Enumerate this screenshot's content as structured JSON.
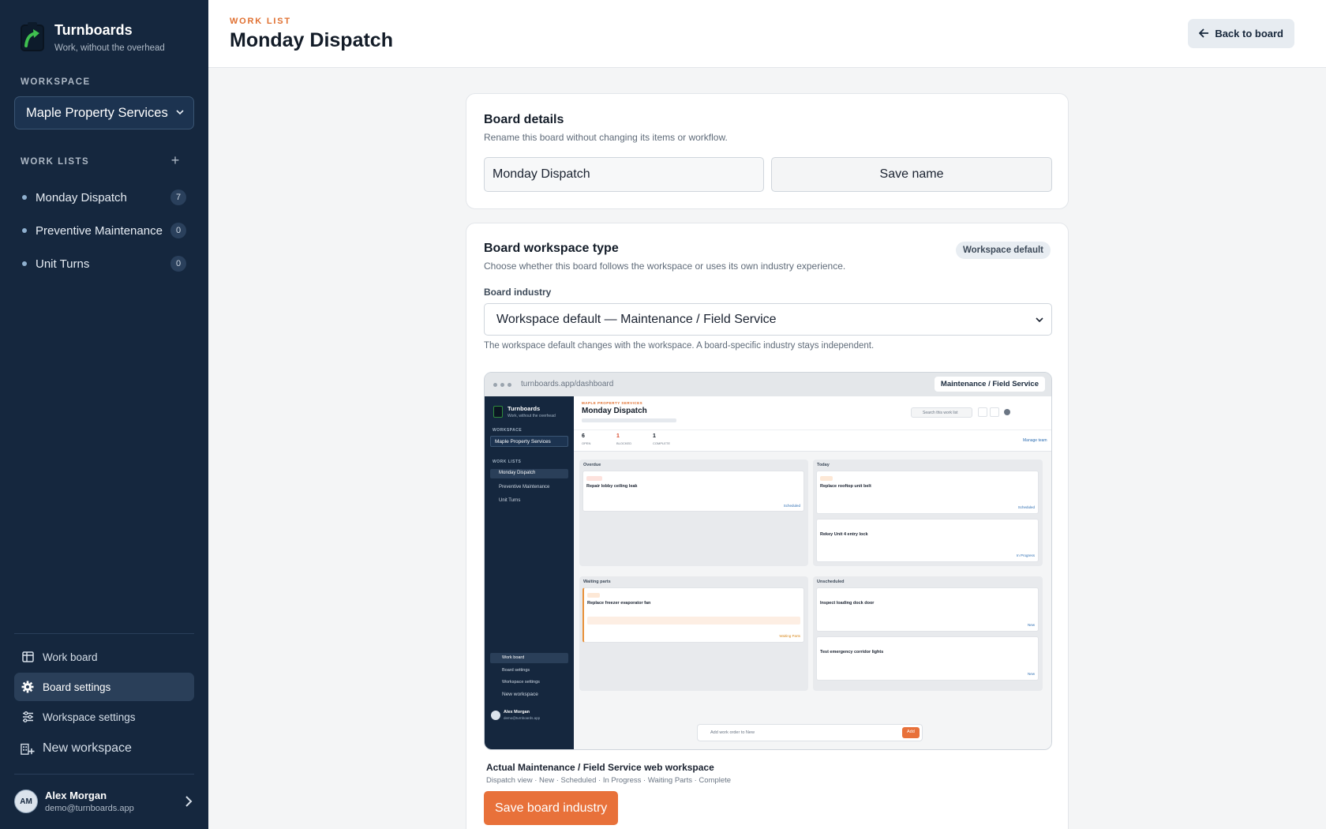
{
  "brand": {
    "name": "Turnboards",
    "tagline": "Work, without the overhead"
  },
  "sidebar": {
    "workspace_label": "WORKSPACE",
    "workspace_value": "Maple Property Services",
    "work_lists_label": "WORK LISTS",
    "work_lists": [
      {
        "label": "Monday Dispatch",
        "count": "7"
      },
      {
        "label": "Preventive Maintenance",
        "count": "0"
      },
      {
        "label": "Unit Turns",
        "count": "0"
      }
    ],
    "nav": [
      {
        "label": "Work board",
        "icon": "board-icon"
      },
      {
        "label": "Board settings",
        "icon": "gear-icon"
      },
      {
        "label": "Workspace settings",
        "icon": "sliders-icon"
      },
      {
        "label": "New workspace",
        "icon": "building-plus-icon"
      }
    ],
    "user": {
      "initials": "AM",
      "name": "Alex Morgan",
      "email": "demo@turnboards.app"
    }
  },
  "header": {
    "eyebrow": "WORK LIST",
    "title": "Monday Dispatch",
    "back_label": "Back to board"
  },
  "board_details": {
    "title": "Board details",
    "description": "Rename this board without changing its items or workflow.",
    "name_value": "Monday Dispatch",
    "save_label": "Save name"
  },
  "board_type": {
    "title": "Board workspace type",
    "badge": "Workspace default",
    "description": "Choose whether this board follows the workspace or uses its own industry experience.",
    "field_label": "Board industry",
    "selected_industry": "Workspace default — Maintenance / Field Service",
    "hint": "The workspace default changes with the workspace. A board-specific industry stays independent.",
    "caption": "Actual Maintenance / Field Service web workspace",
    "subcaption": "Dispatch view · New · Scheduled · In Progress · Waiting Parts · Complete",
    "save_label": "Save board industry"
  },
  "preview": {
    "url": "turnboards.app/dashboard",
    "chip": "Maintenance / Field Service",
    "brand": "Turnboards",
    "tagline": "Work, without the overhead",
    "workspace_label": "WORKSPACE",
    "workspace_value": "Maple Property Services",
    "work_lists_label": "WORK LISTS",
    "lists": [
      "Monday Dispatch",
      "Preventive Maintenance",
      "Unit Turns"
    ],
    "nav": [
      "Work board",
      "Board settings",
      "Workspace settings",
      "New workspace"
    ],
    "user_name": "Alex Morgan",
    "user_mail": "demo@turnboards.app",
    "eyebrow": "MAPLE PROPERTY SERVICES",
    "title": "Monday Dispatch",
    "search": "Search this work list",
    "stats": [
      {
        "value": "6",
        "label": "OPEN"
      },
      {
        "value": "1",
        "label": "BLOCKED"
      },
      {
        "value": "1",
        "label": "COMPLETE"
      }
    ],
    "manage_team": "Manage team",
    "columns": [
      {
        "title": "Overdue",
        "count": "1"
      },
      {
        "title": "Today",
        "count": "2"
      },
      {
        "title": "Waiting parts",
        "count": "1"
      },
      {
        "title": "Unscheduled",
        "count": "2"
      }
    ],
    "cards": [
      {
        "title": "Repair lobby ceiling leak",
        "status": "Scheduled"
      },
      {
        "title": "Replace rooftop unit belt",
        "status": "Scheduled"
      },
      {
        "title": "Rekey Unit 4 entry lock",
        "status": "In Progress"
      },
      {
        "title": "Replace freezer evaporator fan",
        "status": "Waiting Parts"
      },
      {
        "title": "Inspect loading dock door",
        "status": "New"
      },
      {
        "title": "Test emergency corridor lights",
        "status": "New"
      }
    ],
    "add_placeholder": "Add work order to New",
    "add_button": "Add"
  },
  "colors": {
    "sidebar": "#15273e",
    "accent": "#e8713a",
    "page": "#f4f5f6"
  }
}
